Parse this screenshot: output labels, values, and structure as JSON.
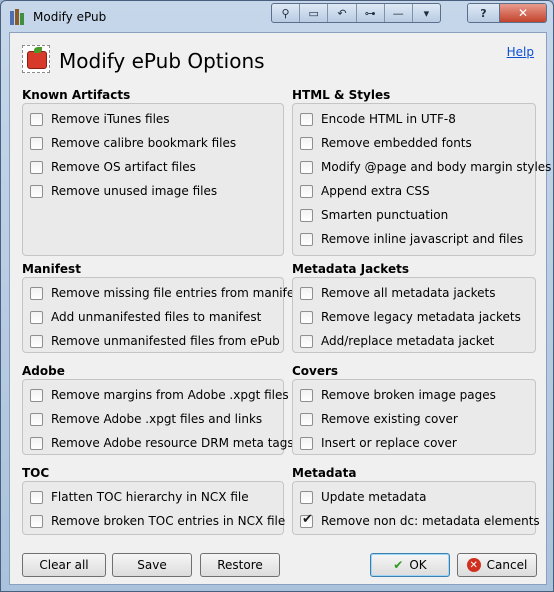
{
  "window": {
    "title": "Modify ePub",
    "toolbar_icons": [
      "pin-icon",
      "restore-window-icon",
      "undo-icon",
      "plugin-icon",
      "minimize-icon",
      "menu-icon"
    ],
    "help_button": "?",
    "close_button": "✕"
  },
  "header": {
    "title": "Modify ePub Options",
    "help_link": "Help"
  },
  "sections": {
    "known_artifacts": {
      "title": "Known Artifacts",
      "options": [
        {
          "label": "Remove iTunes files",
          "checked": false
        },
        {
          "label": "Remove calibre bookmark files",
          "checked": false
        },
        {
          "label": "Remove OS artifact files",
          "checked": false
        },
        {
          "label": "Remove unused image files",
          "checked": false
        }
      ]
    },
    "html_styles": {
      "title": "HTML & Styles",
      "options": [
        {
          "label": "Encode HTML in UTF-8",
          "checked": false
        },
        {
          "label": "Remove embedded fonts",
          "checked": false
        },
        {
          "label": "Modify @page and body margin styles",
          "checked": false
        },
        {
          "label": "Append extra CSS",
          "checked": false
        },
        {
          "label": "Smarten punctuation",
          "checked": false
        },
        {
          "label": "Remove inline javascript and files",
          "checked": false
        }
      ]
    },
    "manifest": {
      "title": "Manifest",
      "options": [
        {
          "label": "Remove missing file entries from manifest",
          "checked": false
        },
        {
          "label": "Add unmanifested files to manifest",
          "checked": false
        },
        {
          "label": "Remove unmanifested files from ePub",
          "checked": false
        }
      ]
    },
    "metadata_jackets": {
      "title": "Metadata Jackets",
      "options": [
        {
          "label": "Remove all metadata jackets",
          "checked": false
        },
        {
          "label": "Remove legacy metadata jackets",
          "checked": false
        },
        {
          "label": "Add/replace metadata jacket",
          "checked": false
        }
      ]
    },
    "adobe": {
      "title": "Adobe",
      "options": [
        {
          "label": "Remove margins from Adobe .xpgt files",
          "checked": false
        },
        {
          "label": "Remove Adobe .xpgt files and links",
          "checked": false
        },
        {
          "label": "Remove Adobe resource DRM meta tags",
          "checked": false
        }
      ]
    },
    "covers": {
      "title": "Covers",
      "options": [
        {
          "label": "Remove broken image pages",
          "checked": false
        },
        {
          "label": "Remove existing cover",
          "checked": false
        },
        {
          "label": "Insert or replace cover",
          "checked": false
        }
      ]
    },
    "toc": {
      "title": "TOC",
      "options": [
        {
          "label": "Flatten TOC hierarchy in NCX file",
          "checked": false
        },
        {
          "label": "Remove broken TOC entries in NCX file",
          "checked": false
        }
      ]
    },
    "metadata": {
      "title": "Metadata",
      "options": [
        {
          "label": "Update metadata",
          "checked": false
        },
        {
          "label": "Remove non dc: metadata elements",
          "checked": true
        }
      ]
    }
  },
  "buttons": {
    "clear_all": "Clear all",
    "save": "Save",
    "restore": "Restore",
    "ok": "OK",
    "cancel": "Cancel"
  },
  "icons": {
    "ok": "check-icon",
    "cancel": "cancel-icon",
    "check_mark": "✔"
  }
}
